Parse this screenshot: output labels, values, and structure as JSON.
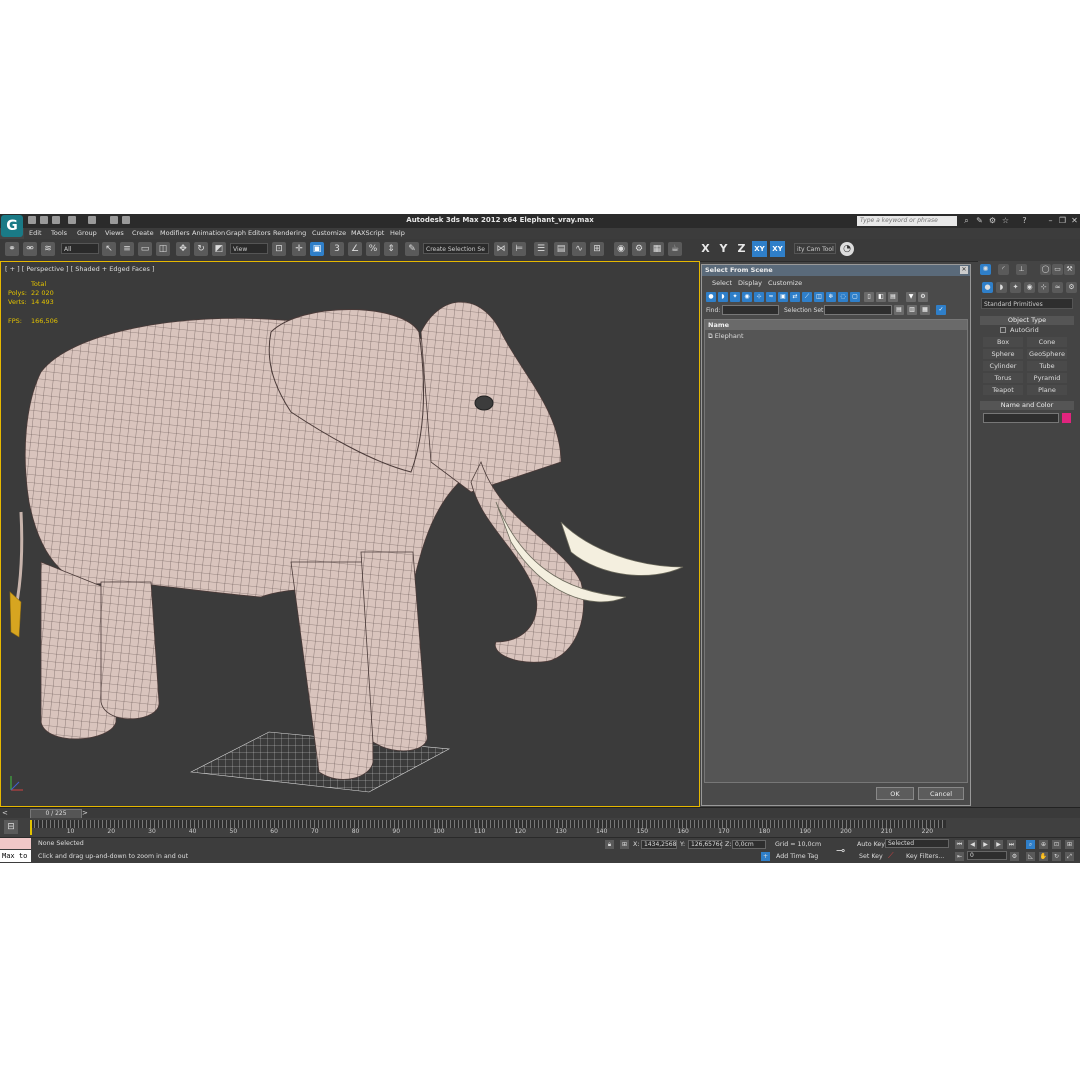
{
  "window": {
    "title": "Autodesk 3ds Max  2012 x64     Elephant_vray.max",
    "search_placeholder": "Type a keyword or phrase"
  },
  "menu": [
    "Edit",
    "Tools",
    "Group",
    "Views",
    "Create",
    "Modifiers",
    "Animation",
    "Graph Editors",
    "Rendering",
    "Customize",
    "MAXScript",
    "Help"
  ],
  "toolbar": {
    "filter_value": "All",
    "ref_coord": "View",
    "selection_set": "Create Selection Se",
    "axes": [
      "X",
      "Y",
      "Z",
      "XY",
      "XY"
    ],
    "cam_tool": "ity Cam Tool"
  },
  "viewport": {
    "label": "[ + ] [ Perspective ] [ Shaded + Edged Faces ]",
    "stats": {
      "total_label": "Total",
      "polys_label": "Polys:",
      "polys_value": "22 020",
      "verts_label": "Verts:",
      "verts_value": "14 493",
      "fps_label": "FPS:",
      "fps_value": "166,506"
    }
  },
  "dialog": {
    "title": "Select From Scene",
    "menu": [
      "Select",
      "Display",
      "Customize"
    ],
    "find_label": "Find:",
    "selection_set_label": "Selection Set:",
    "column_name": "Name",
    "items": [
      "Elephant"
    ],
    "ok": "OK",
    "cancel": "Cancel"
  },
  "command_panel": {
    "category": "Standard Primitives",
    "object_type": "Object Type",
    "autogrid": "AutoGrid",
    "objects": [
      "Box",
      "Cone",
      "Sphere",
      "GeoSphere",
      "Cylinder",
      "Tube",
      "Torus",
      "Pyramid",
      "Teapot",
      "Plane"
    ],
    "name_and_color": "Name and Color",
    "swatch_color": "#e0247e"
  },
  "timeline": {
    "frame_display": "0 / 225",
    "ticks": [
      "10",
      "20",
      "30",
      "40",
      "50",
      "60",
      "70",
      "80",
      "90",
      "100",
      "110",
      "120",
      "130",
      "140",
      "150",
      "160",
      "170",
      "180",
      "190",
      "200",
      "210",
      "220"
    ]
  },
  "status": {
    "script_listener": "Max to",
    "selection": "None Selected",
    "prompt": "Click and drag up-and-down to zoom in and out",
    "x_label": "X:",
    "x_value": "1434,2568",
    "y_label": "Y:",
    "y_value": "126,6576c",
    "z_label": "Z:",
    "z_value": "0,0cm",
    "grid": "Grid = 10,0cm",
    "add_time_tag": "Add Time Tag",
    "auto_key": "Auto Key",
    "set_key": "Set Key",
    "key_mode": "Selected",
    "key_filters": "Key Filters...",
    "current_frame": "0"
  }
}
